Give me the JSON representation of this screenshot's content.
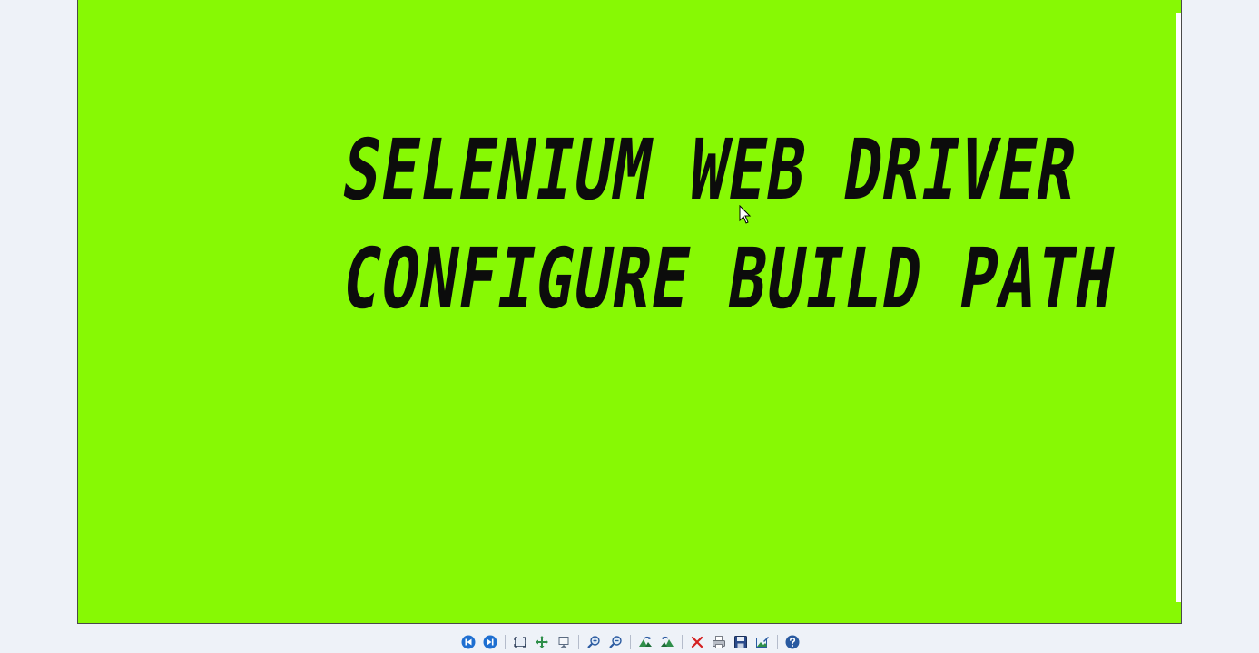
{
  "slide": {
    "line1": "SELENIUM WEB DRIVER",
    "line2": "CONFIGURE BUILD PATH",
    "background": "#87f904",
    "text_color": "#0c0c0c"
  },
  "toolbar": {
    "icons": [
      "previous-icon",
      "next-icon",
      "actual-size-icon",
      "best-fit-icon",
      "slideshow-icon",
      "zoom-in-icon",
      "zoom-out-icon",
      "rotate-clockwise-icon",
      "rotate-counterclockwise-icon",
      "delete-icon",
      "print-icon",
      "save-icon",
      "open-with-icon",
      "help-icon"
    ],
    "accent": "#1f6fd1"
  }
}
